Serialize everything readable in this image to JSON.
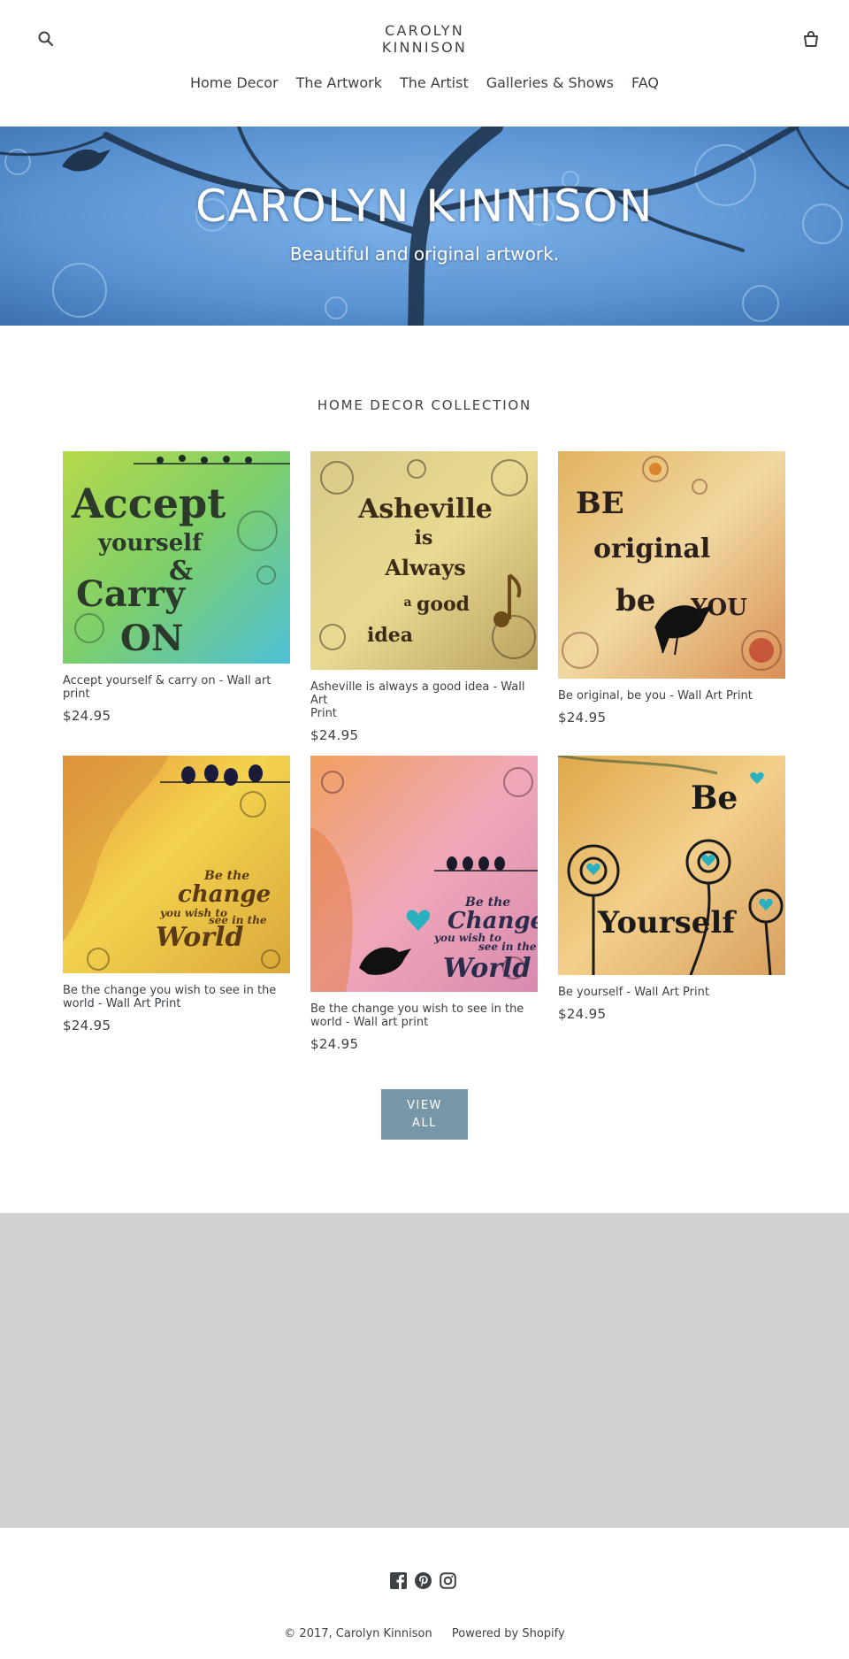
{
  "header": {
    "logo_line1": "CAROLYN",
    "logo_line2": "KINNISON",
    "nav": [
      "Home Decor",
      "The Artwork",
      "The Artist",
      "Galleries & Shows",
      "FAQ"
    ]
  },
  "hero": {
    "title": "CAROLYN KINNISON",
    "subtitle": "Beautiful and original artwork."
  },
  "collection": {
    "title": "HOME DECOR COLLECTION",
    "products": [
      {
        "title_line1": "Accept yourself & carry on - Wall art",
        "title_line2": "print",
        "price": "$24.95"
      },
      {
        "title_line1": "Asheville is always a good idea - Wall Art",
        "title_line2": "Print",
        "price": "$24.95"
      },
      {
        "title_line1": "Be original, be you - Wall Art Print",
        "title_line2": "",
        "price": "$24.95"
      },
      {
        "title_line1": "Be the change you wish to see in the",
        "title_line2": "world - Wall Art Print",
        "price": "$24.95"
      },
      {
        "title_line1": "Be the change you wish to see in the",
        "title_line2": "world - Wall art print",
        "price": "$24.95"
      },
      {
        "title_line1": "Be yourself - Wall Art Print",
        "title_line2": "",
        "price": "$24.95"
      }
    ],
    "artwork_text": {
      "p1": [
        "Accept",
        "yourself",
        "&",
        "Carry",
        "ON"
      ],
      "p2": [
        "Asheville",
        "is",
        "Always",
        "a",
        "good",
        "idea"
      ],
      "p3": [
        "BE",
        "original",
        "be",
        "YOU"
      ],
      "p4": [
        "Be the",
        "change",
        "you wish to",
        "see in the",
        "World"
      ],
      "p5": [
        "Be the",
        "Change",
        "you wish to",
        "see in the",
        "World"
      ],
      "p6": [
        "Be",
        "Yourself"
      ]
    },
    "view_all": "VIEW ALL"
  },
  "footer": {
    "social_icons": [
      "facebook-icon",
      "pinterest-icon",
      "instagram-icon"
    ],
    "copyright": "© 2017, Carolyn Kinnison",
    "powered": "Powered by Shopify"
  },
  "colors": {
    "text": "#3d4246",
    "button": "#7796a8",
    "gray_block": "#d0d1d3",
    "hero_blue": "#5b93d3"
  }
}
